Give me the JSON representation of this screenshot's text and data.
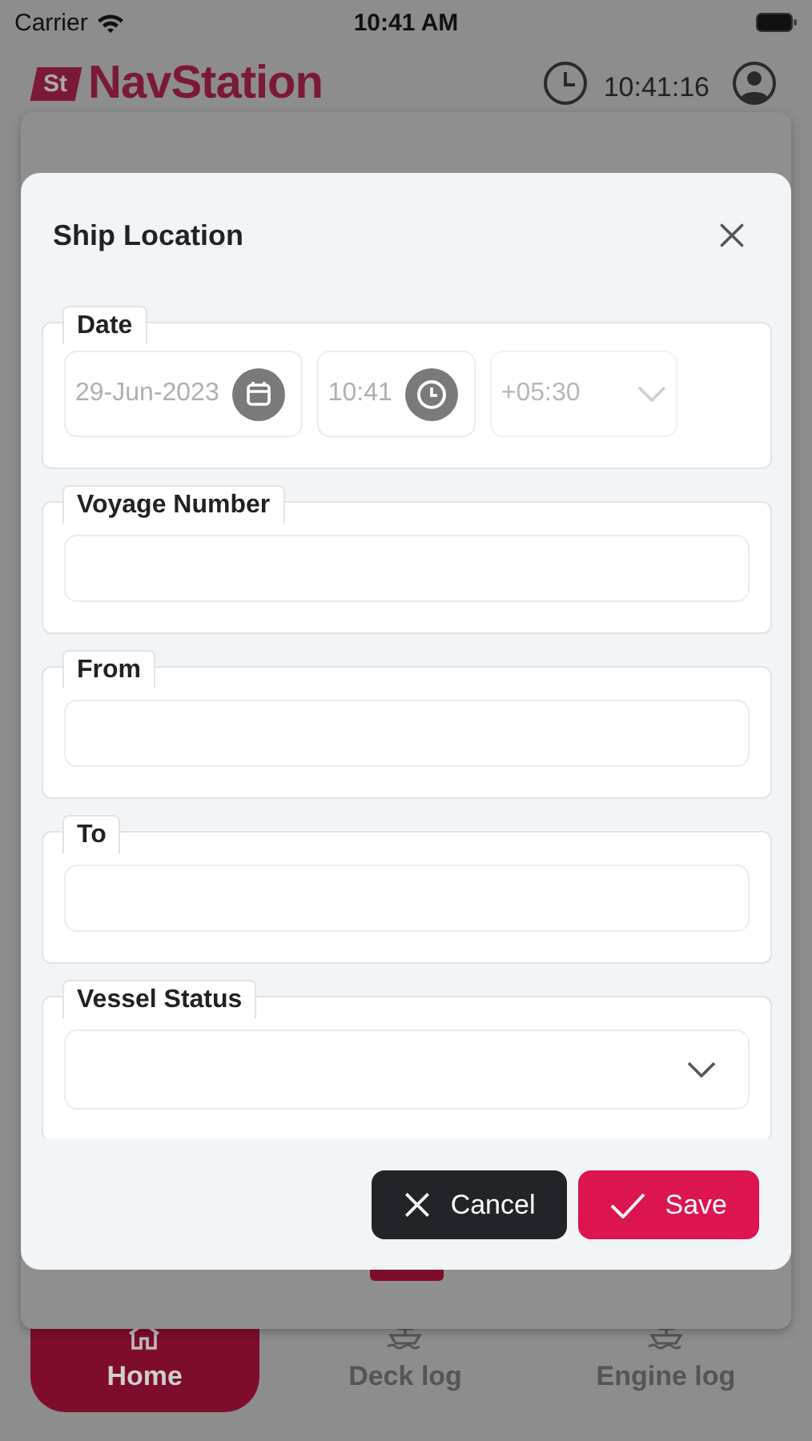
{
  "status_bar": {
    "carrier": "Carrier",
    "time": "10:41 AM"
  },
  "header": {
    "logo_badge": "St",
    "app_name": "NavStation",
    "clock": "10:41:16"
  },
  "dialog": {
    "title": "Ship Location",
    "fields": [
      {
        "kind": "datetime",
        "label": "Date",
        "date": "29-Jun-2023",
        "time": "10:41",
        "timezone": "+05:30"
      },
      {
        "kind": "text",
        "label": "Voyage Number"
      },
      {
        "kind": "text",
        "label": "From"
      },
      {
        "kind": "text",
        "label": "To"
      },
      {
        "kind": "select",
        "label": "Vessel Status"
      }
    ],
    "buttons": [
      {
        "kind": "cancel",
        "label": "Cancel"
      },
      {
        "kind": "save",
        "label": "Save"
      }
    ]
  },
  "nav": [
    {
      "kind": "home",
      "label": "Home",
      "selected": true
    },
    {
      "kind": "deck",
      "label": "Deck log",
      "selected": false
    },
    {
      "kind": "engine",
      "label": "Engine log",
      "selected": false
    }
  ]
}
